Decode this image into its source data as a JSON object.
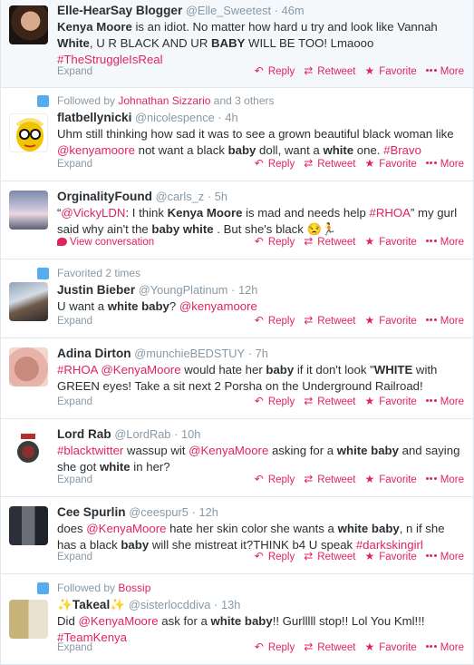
{
  "labels": {
    "expand": "Expand",
    "reply": "Reply",
    "retweet": "Retweet",
    "favorite": "Favorite",
    "more": "More",
    "view_conversation": "View conversation",
    "dot": "·"
  },
  "colors": {
    "accent": "#e0245e",
    "muted": "#8899a6",
    "text": "#292f33",
    "context_icon": "#55acee",
    "highlight_bg": "#f5f8fa"
  },
  "tweets": [
    {
      "name": "Elle-HearSay Blogger",
      "handle": "@Elle_Sweetest",
      "time": "46m",
      "text": [
        {
          "t": "Kenya Moore",
          "s": "b"
        },
        {
          "t": " is an idiot. No matter how hard u try and look like Vannah "
        },
        {
          "t": "White",
          "s": "b"
        },
        {
          "t": ", U R BLACK AND UR "
        },
        {
          "t": "BABY",
          "s": "b"
        },
        {
          "t": " WILL BE TOO! Lmaooo "
        },
        {
          "t": "#TheStruggleIsReal",
          "s": "h"
        }
      ]
    },
    {
      "context": "Followed by",
      "context_accent": "Johnathan Sizzario",
      "context_rest": " and 3 others",
      "name": "flatbellynicki",
      "handle": "@nicolespence",
      "time": "4h",
      "text": [
        {
          "t": "Uhm still thinking how sad it was to see a grown beautiful black woman like "
        },
        {
          "t": "@kenyamoore",
          "s": "h"
        },
        {
          "t": " not want a black "
        },
        {
          "t": "baby",
          "s": "b"
        },
        {
          "t": " doll, want a "
        },
        {
          "t": "white",
          "s": "b"
        },
        {
          "t": " one. "
        },
        {
          "t": "#Bravo",
          "s": "h"
        }
      ]
    },
    {
      "name": "OrginalityFound",
      "handle": "@carls_z",
      "time": "5h",
      "text": [
        {
          "t": "“"
        },
        {
          "t": "@VickyLDN",
          "s": "h"
        },
        {
          "t": ": I think "
        },
        {
          "t": "Kenya Moore",
          "s": "b"
        },
        {
          "t": " is mad and needs help "
        },
        {
          "t": "#RHOA",
          "s": "h"
        },
        {
          "t": "” my gurl said why ain't the "
        },
        {
          "t": "baby white",
          "s": "b"
        },
        {
          "t": " . But she's black 😒🏃"
        }
      ],
      "footer_left": "view_conversation"
    },
    {
      "context": "Favorited 2 times",
      "context_accent": "",
      "context_rest": "",
      "name": "Justin Bieber",
      "handle": "@YoungPlatinum",
      "time": "12h",
      "text": [
        {
          "t": "U want a "
        },
        {
          "t": "white baby",
          "s": "b"
        },
        {
          "t": "? "
        },
        {
          "t": "@kenyamoore",
          "s": "h"
        }
      ]
    },
    {
      "name": "Adina Dirton",
      "handle": "@munchieBEDSTUY",
      "time": "7h",
      "text": [
        {
          "t": "#RHOA",
          "s": "h"
        },
        {
          "t": " "
        },
        {
          "t": "@KenyaMoore",
          "s": "h"
        },
        {
          "t": " would hate her "
        },
        {
          "t": "baby",
          "s": "b"
        },
        {
          "t": " if it don't look \""
        },
        {
          "t": "WHITE",
          "s": "b"
        },
        {
          "t": " with GREEN eyes! Take a sit next 2 Porsha on the Underground Railroad!"
        }
      ]
    },
    {
      "name": "Lord Rab",
      "handle": "@LordRab",
      "time": "10h",
      "text": [
        {
          "t": "#blacktwitter",
          "s": "h"
        },
        {
          "t": " wassup wit "
        },
        {
          "t": "@KenyaMoore",
          "s": "h"
        },
        {
          "t": " asking for a "
        },
        {
          "t": "white baby",
          "s": "b"
        },
        {
          "t": " and saying she got "
        },
        {
          "t": "white",
          "s": "b"
        },
        {
          "t": " in her?"
        }
      ]
    },
    {
      "name": "Cee Spurlin",
      "handle": "@ceespur5",
      "time": "12h",
      "text": [
        {
          "t": "does "
        },
        {
          "t": "@KenyaMoore",
          "s": "h"
        },
        {
          "t": " hate her skin color she wants a "
        },
        {
          "t": "white baby",
          "s": "b"
        },
        {
          "t": ", n if she has a black "
        },
        {
          "t": "baby",
          "s": "b"
        },
        {
          "t": " will she mistreat it?THINK b4 U speak "
        },
        {
          "t": "#darkskingirl",
          "s": "h"
        }
      ]
    },
    {
      "context": "Followed by",
      "context_accent": "Bossip",
      "context_rest": "",
      "name": "✨Takeal✨",
      "handle": "@sisterlocddiva",
      "time": "13h",
      "text": [
        {
          "t": "Did "
        },
        {
          "t": "@KenyaMoore",
          "s": "h"
        },
        {
          "t": " ask for a "
        },
        {
          "t": "white baby",
          "s": "b"
        },
        {
          "t": "!! Gurlllll stop!! Lol You Kml!!! "
        },
        {
          "t": "#TeamKenya",
          "s": "h"
        }
      ]
    }
  ]
}
